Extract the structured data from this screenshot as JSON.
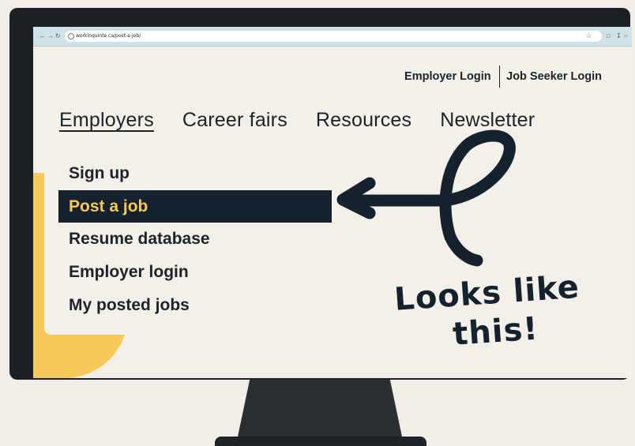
{
  "browser": {
    "url": "workinquinte.ca/post-a-job/",
    "nav_icons": [
      "back-icon",
      "forward-icon",
      "reload-icon"
    ],
    "toolbar_icons": [
      "star-icon",
      "page-icon",
      "download-icon",
      "extension-icon"
    ]
  },
  "header": {
    "employer_login": "Employer Login",
    "job_seeker_login": "Job Seeker Login"
  },
  "nav": {
    "items": [
      {
        "label": "Employers",
        "active": true
      },
      {
        "label": "Career fairs",
        "active": false
      },
      {
        "label": "Resources",
        "active": false
      },
      {
        "label": "Newsletter",
        "active": false
      }
    ]
  },
  "dropdown": {
    "items": [
      {
        "label": "Sign up",
        "selected": false
      },
      {
        "label": "Post a job",
        "selected": true
      },
      {
        "label": "Resume database",
        "selected": false
      },
      {
        "label": "Employer login",
        "selected": false
      },
      {
        "label": "My posted jobs",
        "selected": false
      }
    ]
  },
  "annotation": {
    "line1": "Looks like",
    "line2": "this!"
  },
  "colors": {
    "accent_yellow": "#f7c85a",
    "navy": "#15222e",
    "page_bg": "#f2f0e8",
    "browser_bar": "#cfe3e6"
  }
}
